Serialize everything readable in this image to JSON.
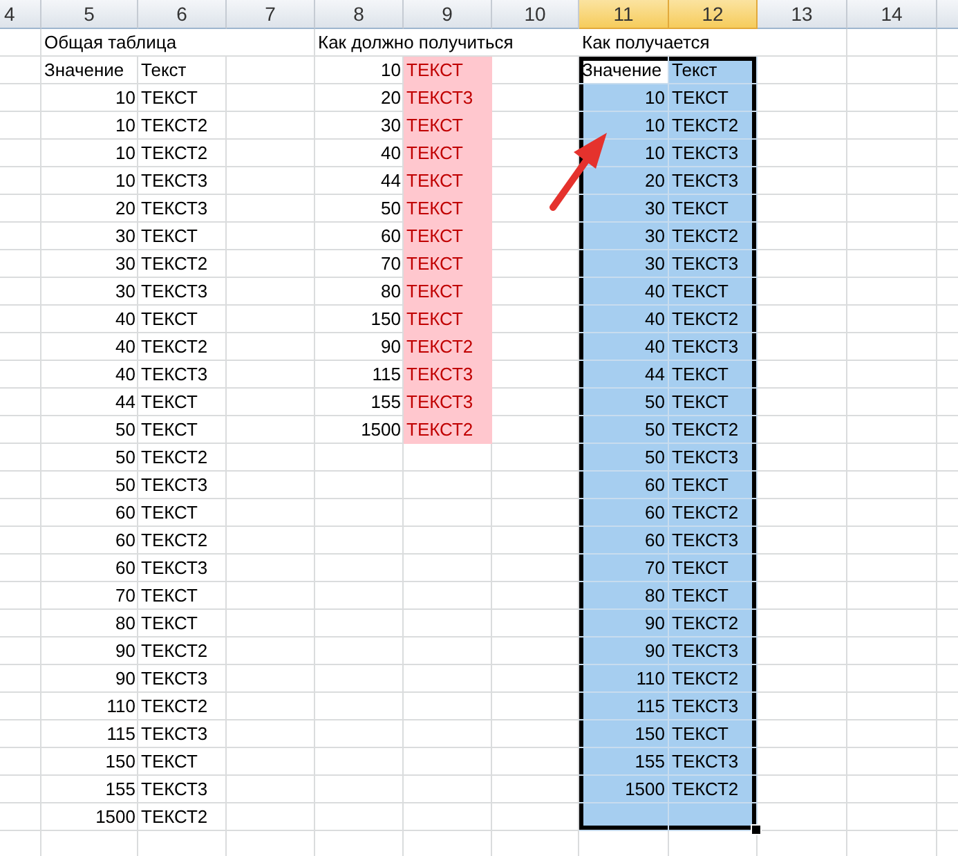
{
  "column_headers": [
    {
      "label": "4",
      "selected": false
    },
    {
      "label": "5",
      "selected": false
    },
    {
      "label": "6",
      "selected": false
    },
    {
      "label": "7",
      "selected": false
    },
    {
      "label": "8",
      "selected": false
    },
    {
      "label": "9",
      "selected": false
    },
    {
      "label": "10",
      "selected": false
    },
    {
      "label": "11",
      "selected": true
    },
    {
      "label": "12",
      "selected": true
    },
    {
      "label": "13",
      "selected": false
    },
    {
      "label": "14",
      "selected": false
    }
  ],
  "general_table": {
    "title": "Общая таблица",
    "headers": [
      "Значение",
      "Текст"
    ],
    "rows": [
      {
        "value": "10",
        "text": "ТЕКСТ"
      },
      {
        "value": "10",
        "text": "ТЕКСТ2"
      },
      {
        "value": "10",
        "text": "ТЕКСТ2"
      },
      {
        "value": "10",
        "text": "ТЕКСТ3"
      },
      {
        "value": "20",
        "text": "ТЕКСТ3"
      },
      {
        "value": "30",
        "text": "ТЕКСТ"
      },
      {
        "value": "30",
        "text": "ТЕКСТ2"
      },
      {
        "value": "30",
        "text": "ТЕКСТ3"
      },
      {
        "value": "40",
        "text": "ТЕКСТ"
      },
      {
        "value": "40",
        "text": "ТЕКСТ2"
      },
      {
        "value": "40",
        "text": "ТЕКСТ3"
      },
      {
        "value": "44",
        "text": "ТЕКСТ"
      },
      {
        "value": "50",
        "text": "ТЕКСТ"
      },
      {
        "value": "50",
        "text": "ТЕКСТ2"
      },
      {
        "value": "50",
        "text": "ТЕКСТ3"
      },
      {
        "value": "60",
        "text": "ТЕКСТ"
      },
      {
        "value": "60",
        "text": "ТЕКСТ2"
      },
      {
        "value": "60",
        "text": "ТЕКСТ3"
      },
      {
        "value": "70",
        "text": "ТЕКСТ"
      },
      {
        "value": "80",
        "text": "ТЕКСТ"
      },
      {
        "value": "90",
        "text": "ТЕКСТ2"
      },
      {
        "value": "90",
        "text": "ТЕКСТ3"
      },
      {
        "value": "110",
        "text": "ТЕКСТ2"
      },
      {
        "value": "115",
        "text": "ТЕКСТ3"
      },
      {
        "value": "150",
        "text": "ТЕКСТ"
      },
      {
        "value": "155",
        "text": "ТЕКСТ3"
      },
      {
        "value": "1500",
        "text": "ТЕКСТ2"
      }
    ]
  },
  "expected_table": {
    "title": "Как должно получиться",
    "rows": [
      {
        "value": "10",
        "text": "ТЕКСТ"
      },
      {
        "value": "20",
        "text": "ТЕКСТ3"
      },
      {
        "value": "30",
        "text": "ТЕКСТ"
      },
      {
        "value": "40",
        "text": "ТЕКСТ"
      },
      {
        "value": "44",
        "text": "ТЕКСТ"
      },
      {
        "value": "50",
        "text": "ТЕКСТ"
      },
      {
        "value": "60",
        "text": "ТЕКСТ"
      },
      {
        "value": "70",
        "text": "ТЕКСТ"
      },
      {
        "value": "80",
        "text": "ТЕКСТ"
      },
      {
        "value": "150",
        "text": "ТЕКСТ"
      },
      {
        "value": "90",
        "text": "ТЕКСТ2"
      },
      {
        "value": "115",
        "text": "ТЕКСТ3"
      },
      {
        "value": "155",
        "text": "ТЕКСТ3"
      },
      {
        "value": "1500",
        "text": "ТЕКСТ2"
      }
    ]
  },
  "actual_table": {
    "title": "Как получается",
    "selected": true,
    "headers": [
      "Значение",
      "Текст"
    ],
    "rows": [
      {
        "value": "10",
        "text": "ТЕКСТ"
      },
      {
        "value": "10",
        "text": "ТЕКСТ2"
      },
      {
        "value": "10",
        "text": "ТЕКСТ3"
      },
      {
        "value": "20",
        "text": "ТЕКСТ3"
      },
      {
        "value": "30",
        "text": "ТЕКСТ"
      },
      {
        "value": "30",
        "text": "ТЕКСТ2"
      },
      {
        "value": "30",
        "text": "ТЕКСТ3"
      },
      {
        "value": "40",
        "text": "ТЕКСТ"
      },
      {
        "value": "40",
        "text": "ТЕКСТ2"
      },
      {
        "value": "40",
        "text": "ТЕКСТ3"
      },
      {
        "value": "44",
        "text": "ТЕКСТ"
      },
      {
        "value": "50",
        "text": "ТЕКСТ"
      },
      {
        "value": "50",
        "text": "ТЕКСТ2"
      },
      {
        "value": "50",
        "text": "ТЕКСТ3"
      },
      {
        "value": "60",
        "text": "ТЕКСТ"
      },
      {
        "value": "60",
        "text": "ТЕКСТ2"
      },
      {
        "value": "60",
        "text": "ТЕКСТ3"
      },
      {
        "value": "70",
        "text": "ТЕКСТ"
      },
      {
        "value": "80",
        "text": "ТЕКСТ"
      },
      {
        "value": "90",
        "text": "ТЕКСТ2"
      },
      {
        "value": "90",
        "text": "ТЕКСТ3"
      },
      {
        "value": "110",
        "text": "ТЕКСТ2"
      },
      {
        "value": "115",
        "text": "ТЕКСТ3"
      },
      {
        "value": "150",
        "text": "ТЕКСТ"
      },
      {
        "value": "155",
        "text": "ТЕКСТ3"
      },
      {
        "value": "1500",
        "text": "ТЕКСТ2"
      }
    ]
  }
}
